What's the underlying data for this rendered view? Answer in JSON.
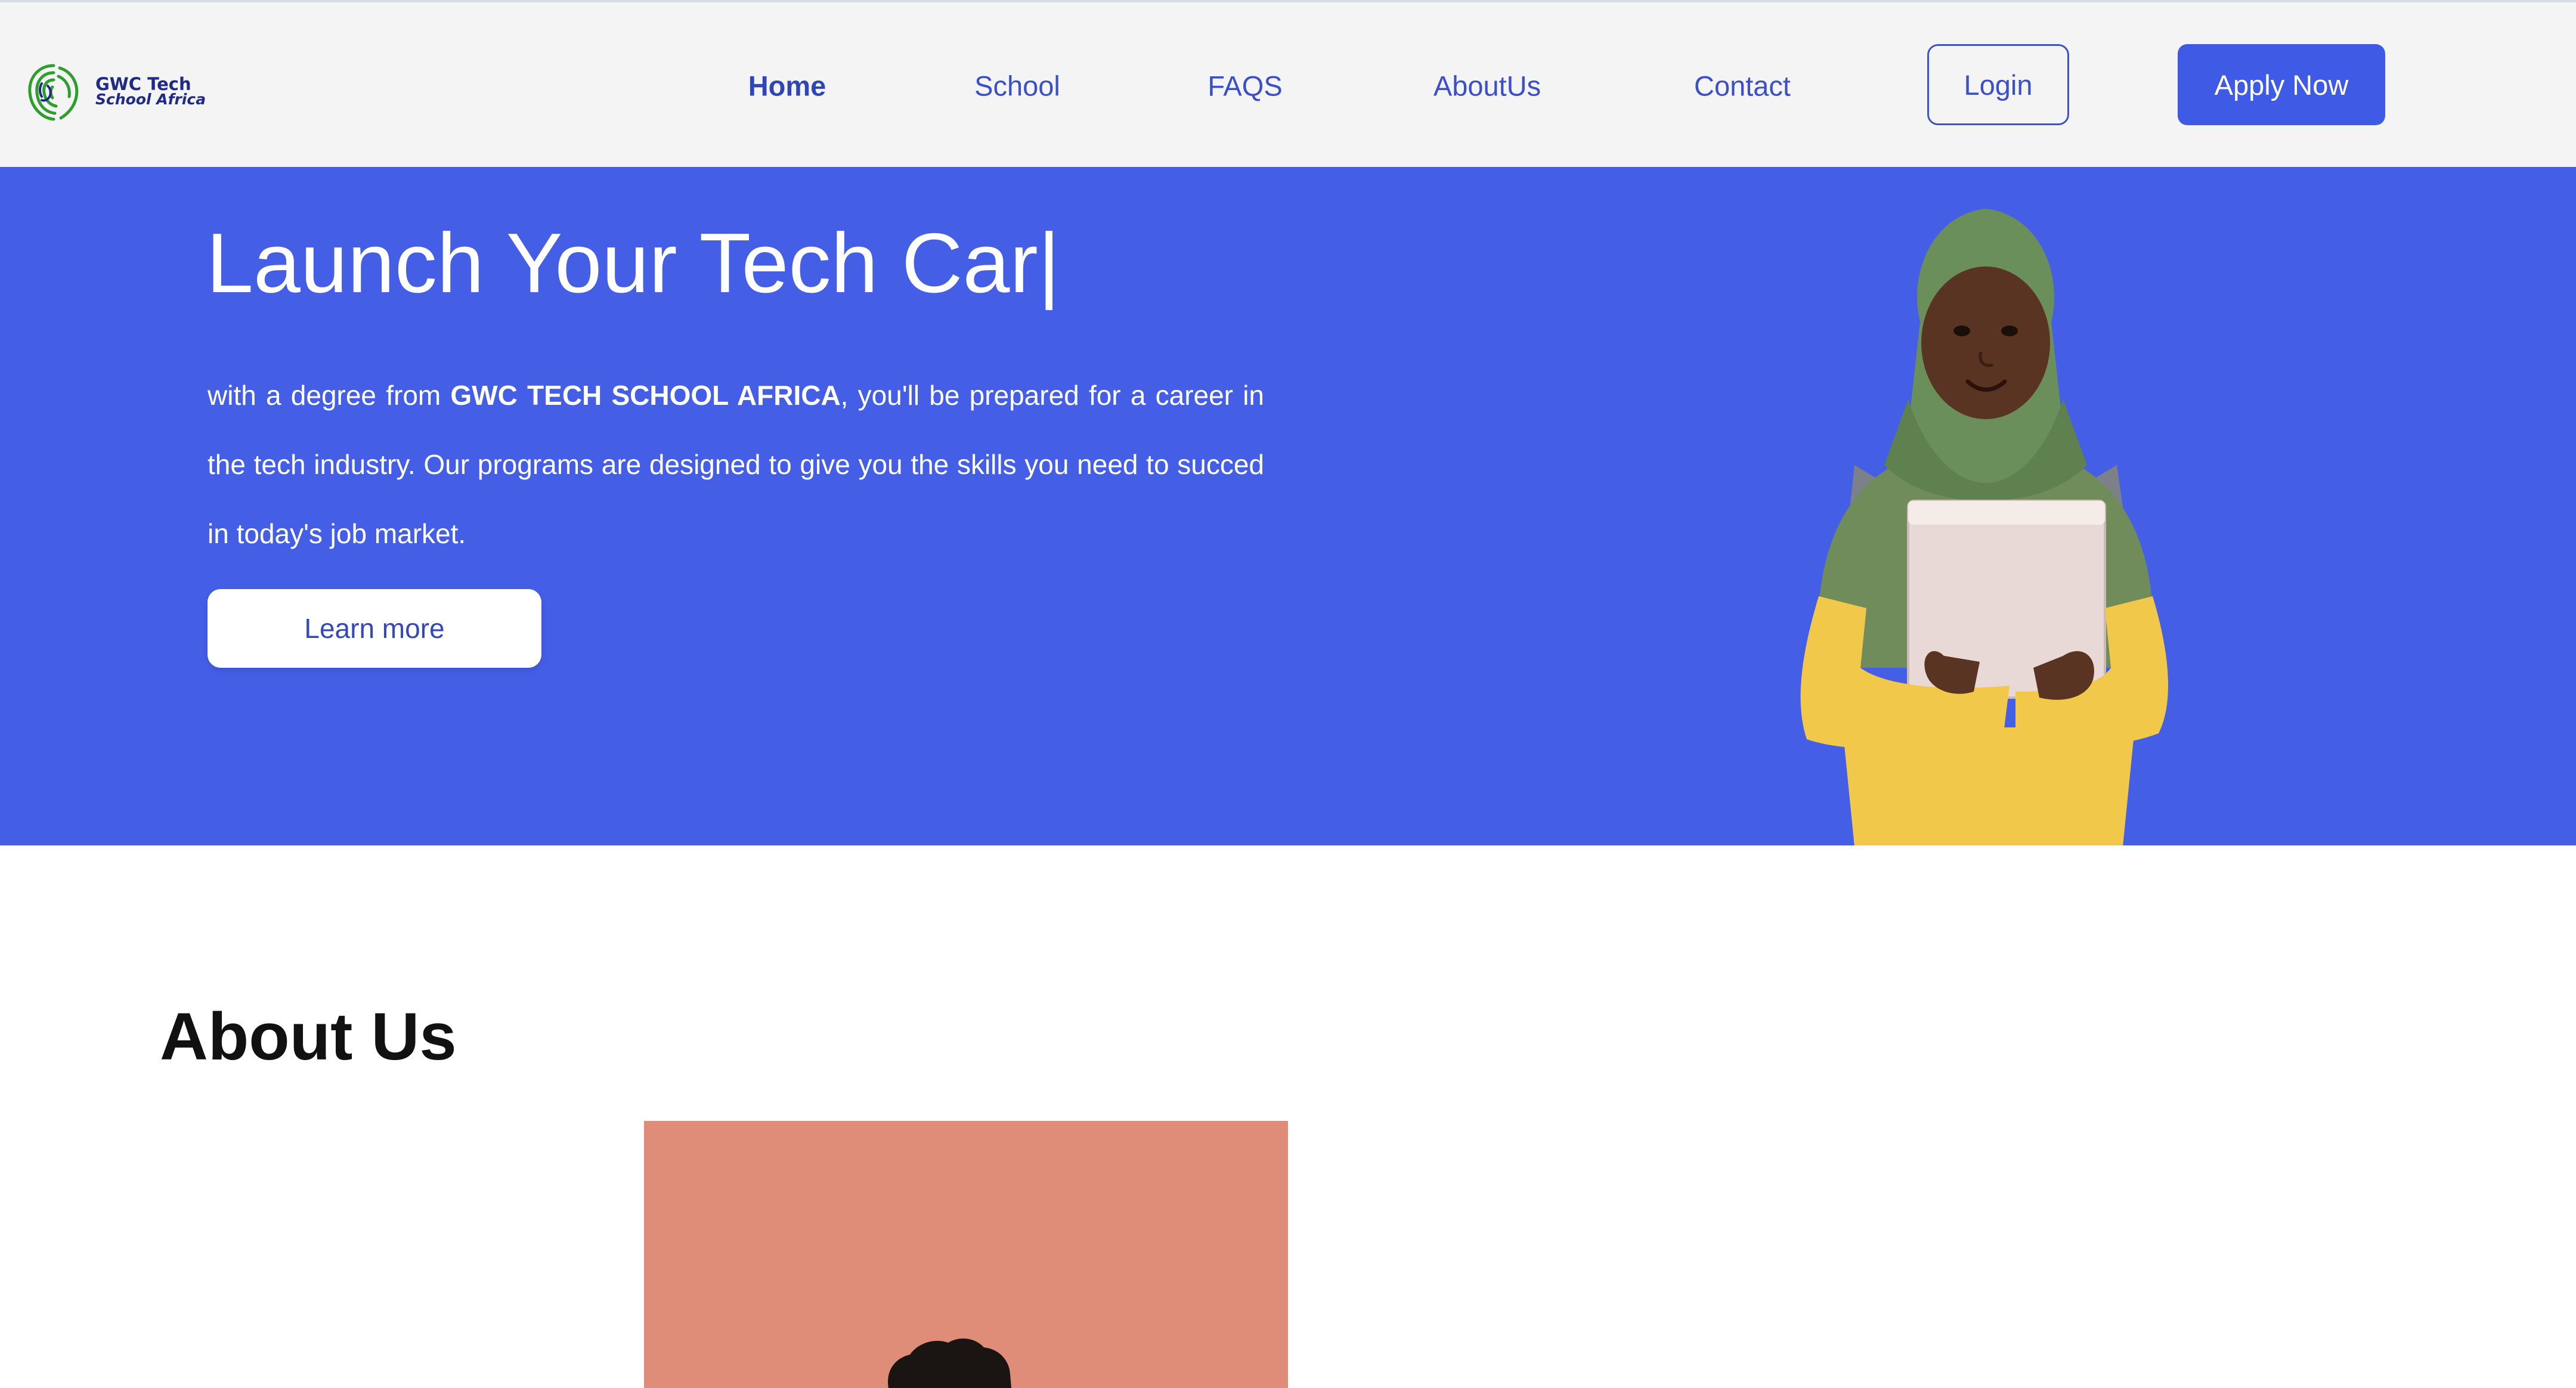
{
  "brand": {
    "line1": "GWC Tech",
    "line2": "School Africa",
    "logo_icon": "fingerprint-logo-icon",
    "logo_color": "#2f9e2f"
  },
  "nav": {
    "links": [
      {
        "id": "home",
        "label": "Home",
        "active": true
      },
      {
        "id": "school",
        "label": "School"
      },
      {
        "id": "faqs",
        "label": "FAQS"
      },
      {
        "id": "about",
        "label": "AboutUs"
      },
      {
        "id": "contact",
        "label": "Contact"
      }
    ],
    "login_label": "Login",
    "apply_label": "Apply Now"
  },
  "hero": {
    "title": "Launch Your Tech Car",
    "cursor": "|",
    "desc_before": "with a degree from ",
    "desc_bold": "GWC TECH SCHOOL AFRICA",
    "desc_after": ", you'll be prepared for a career in the tech industry. Our programs are designed to give you the skills you need to succed in today's job market.",
    "cta_label": "Learn more"
  },
  "about": {
    "heading": "About Us"
  },
  "colors": {
    "primary": "#445ee6",
    "button": "#3f5be5",
    "nav_bg": "#f4f4f4",
    "about_photo_bg": "#df8c78"
  }
}
